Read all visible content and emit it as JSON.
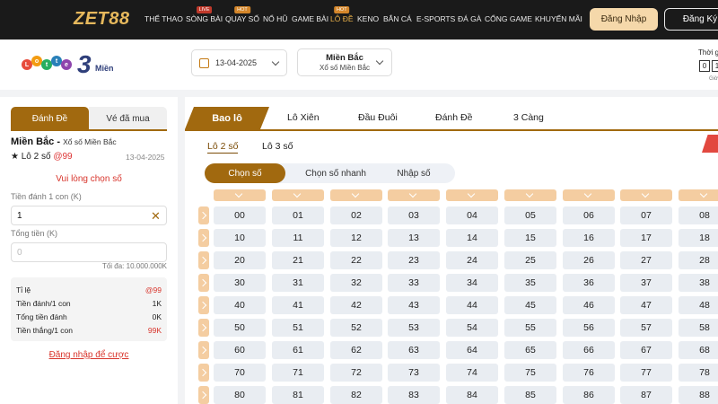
{
  "brand": {
    "logo_text": "ZET88",
    "lottery_logo_balls": [
      "L",
      "o",
      "t",
      "t",
      "e"
    ],
    "lottery_logo_number": "3",
    "lottery_logo_suffix": "Miền"
  },
  "nav": {
    "items": [
      {
        "label": "THỂ THAO",
        "badge": ""
      },
      {
        "label": "SÒNG BÀI",
        "badge": "LIVE"
      },
      {
        "label": "QUAY SỐ",
        "badge": "HOT"
      },
      {
        "label": "NỔ HŨ",
        "badge": ""
      },
      {
        "label": "GAME BÀI",
        "badge": ""
      },
      {
        "label": "LÔ ĐỀ",
        "badge": "HOT"
      },
      {
        "label": "KENO",
        "badge": ""
      },
      {
        "label": "BẮN CÁ",
        "badge": ""
      },
      {
        "label": "E-SPORTS",
        "badge": ""
      },
      {
        "label": "ĐÁ GÀ",
        "badge": ""
      },
      {
        "label": "CỔNG GAME",
        "badge": ""
      },
      {
        "label": "KHUYẾN MÃI",
        "badge": ""
      }
    ],
    "active": "LÔ ĐỀ",
    "login": "Đăng Nhập",
    "register": "Đăng Ký"
  },
  "filters": {
    "date": "13-04-2025",
    "region_title": "Miền Bắc",
    "region_sub": "Xổ số Miền Bắc",
    "time_label": "Thời g",
    "time_digits": [
      "0",
      "1"
    ],
    "time_small": "Giờ"
  },
  "left": {
    "tabs": [
      "Đánh Đề",
      "Vé đã mua"
    ],
    "title": "Miền Bắc -",
    "title_sub": "Xổ số Miền Bắc",
    "bet_type": "★ Lô 2 số",
    "odds": "@99",
    "date": "13-04-2025",
    "warning": "Vui lòng chọn số",
    "stake_label": "Tiền đánh 1 con (K)",
    "stake_value": "1",
    "total_label": "Tổng tiền (K)",
    "total_placeholder": "0",
    "max_text": "Tối đa: 10.000.000K",
    "summary": [
      {
        "label": "Tỉ lệ",
        "value": "@99"
      },
      {
        "label": "Tiền đánh/1 con",
        "value": "1K"
      },
      {
        "label": "Tổng tiền đánh",
        "value": "0K"
      },
      {
        "label": "Tiền thắng/1 con",
        "value": "99K"
      }
    ],
    "login_link": "Đăng nhập để cược"
  },
  "main": {
    "type_tabs": [
      "Bao lô",
      "Lô Xiên",
      "Đầu Đuôi",
      "Đánh Đề",
      "3 Càng"
    ],
    "sub_tabs": [
      "Lô 2 số",
      "Lô 3 số"
    ],
    "modes": [
      "Chọn số",
      "Chọn số nhanh",
      "Nhập số"
    ],
    "grid_rows": [
      [
        "00",
        "01",
        "02",
        "03",
        "04",
        "05",
        "06",
        "07",
        "08"
      ],
      [
        "10",
        "11",
        "12",
        "13",
        "14",
        "15",
        "16",
        "17",
        "18"
      ],
      [
        "20",
        "21",
        "22",
        "23",
        "24",
        "25",
        "26",
        "27",
        "28"
      ],
      [
        "30",
        "31",
        "32",
        "33",
        "34",
        "35",
        "36",
        "37",
        "38"
      ],
      [
        "40",
        "41",
        "42",
        "43",
        "44",
        "45",
        "46",
        "47",
        "48"
      ],
      [
        "50",
        "51",
        "52",
        "53",
        "54",
        "55",
        "56",
        "57",
        "58"
      ],
      [
        "60",
        "61",
        "62",
        "63",
        "64",
        "65",
        "66",
        "67",
        "68"
      ],
      [
        "70",
        "71",
        "72",
        "73",
        "74",
        "75",
        "76",
        "77",
        "78"
      ],
      [
        "80",
        "81",
        "82",
        "83",
        "84",
        "85",
        "86",
        "87",
        "88"
      ]
    ]
  },
  "colors": {
    "accent": "#a1690f",
    "danger": "#d8342b",
    "cell_bg": "#e9edf2",
    "header_bg": "#f4cda1"
  }
}
